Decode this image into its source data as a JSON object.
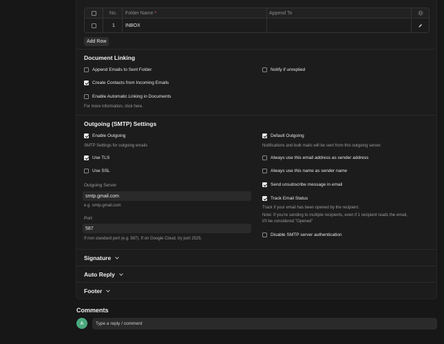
{
  "grid": {
    "headers": {
      "no": "No.",
      "folder_name": "Folder Name",
      "append_to": "Append To"
    },
    "rows": [
      {
        "no": "1",
        "folder_name": "INBOX",
        "append_to": ""
      }
    ],
    "add_row_label": "Add Row"
  },
  "document_linking": {
    "title": "Document Linking",
    "append_sent": {
      "label": "Append Emails to Sent Folder",
      "checked": false
    },
    "notify_unreplied": {
      "label": "Notify if unreplied",
      "checked": false
    },
    "create_contacts": {
      "label": "Create Contacts from Incoming Emails",
      "checked": true
    },
    "auto_linking": {
      "label": "Enable Automatic Linking in Documents",
      "checked": false
    },
    "more_info": "For more information, click here."
  },
  "smtp": {
    "title": "Outgoing (SMTP) Settings",
    "enable_outgoing": {
      "label": "Enable Outgoing",
      "checked": true
    },
    "enable_outgoing_help": "SMTP Settings for outgoing emails",
    "default_outgoing": {
      "label": "Default Outgoing",
      "checked": true
    },
    "default_outgoing_help": "Notifications and bulk mails will be sent from this outgoing server.",
    "use_tls": {
      "label": "Use TLS",
      "checked": true
    },
    "use_ssl": {
      "label": "Use SSL",
      "checked": false
    },
    "always_email": {
      "label": "Always use this email address as sender address",
      "checked": false
    },
    "always_name": {
      "label": "Always use this name as sender name",
      "checked": false
    },
    "send_unsub": {
      "label": "Send unsubscribe message in email",
      "checked": true
    },
    "track_status": {
      "label": "Track Email Status",
      "checked": true
    },
    "track_help_1": "Track if your email has been opened by the recipient.",
    "track_help_2": "Note: If you're sending to multiple recipients, even if 1 recipient reads the email,",
    "track_help_3": "it'll be considered \"Opened\"",
    "disable_auth": {
      "label": "Disable SMTP server authentication",
      "checked": false
    },
    "server_label": "Outgoing Server",
    "server_value": "smtp.gmail.com",
    "server_help": "e.g. smtp.gmail.com",
    "port_label": "Port",
    "port_value": "587",
    "port_help": "If non standard port (e.g. 587). If on Google Cloud, try port 2525."
  },
  "sections": {
    "signature": "Signature",
    "auto_reply": "Auto Reply",
    "footer": "Footer"
  },
  "comments": {
    "title": "Comments",
    "avatar_initial": "A",
    "placeholder": "Type a reply / comment"
  }
}
